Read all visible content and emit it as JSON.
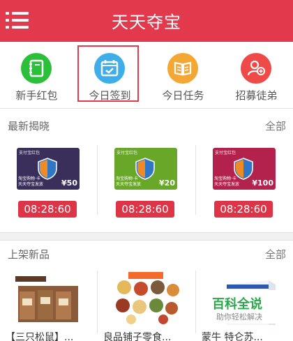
{
  "header": {
    "title": "天天夺宝",
    "menu_icon": "menu-icon"
  },
  "quick_actions": [
    {
      "label": "新手红包",
      "icon": "notebook-icon",
      "color": "#2cbf3a"
    },
    {
      "label": "今日签到",
      "icon": "calendar-check-icon",
      "color": "#3daee9"
    },
    {
      "label": "今日任务",
      "icon": "open-book-icon",
      "color": "#f5a733"
    },
    {
      "label": "招募徒弟",
      "icon": "add-user-icon",
      "color": "#ee4a47"
    }
  ],
  "latest": {
    "title": "最新揭晓",
    "more": "全部",
    "items": [
      {
        "card_top": "支付宝红包",
        "card_bottom_1": "淘宝购物·卡",
        "card_bottom_2": "天天夺宝发放",
        "amount": "¥50",
        "color": "#3a2f5a",
        "timer": "08:28:60"
      },
      {
        "card_top": "支付宝红包",
        "card_bottom_1": "淘宝购物·卡",
        "card_bottom_2": "天天夺宝发放",
        "amount": "¥20",
        "color": "#69a728",
        "timer": "08:28:60"
      },
      {
        "card_top": "支付宝红包",
        "card_bottom_1": "淘宝购物·卡",
        "card_bottom_2": "天天夺宝发放",
        "amount": "¥100",
        "color": "#b3214d",
        "timer": "08:28:60"
      }
    ]
  },
  "new_arrivals": {
    "title": "上架新品",
    "more": "全部",
    "items": [
      {
        "name": "【三只松鼠】..."
      },
      {
        "name": "良品铺子零食..."
      },
      {
        "name": "蒙牛 特仑苏..."
      }
    ]
  },
  "watermark": {
    "title": "百科全说",
    "subtitle": "助你轻松解决"
  }
}
